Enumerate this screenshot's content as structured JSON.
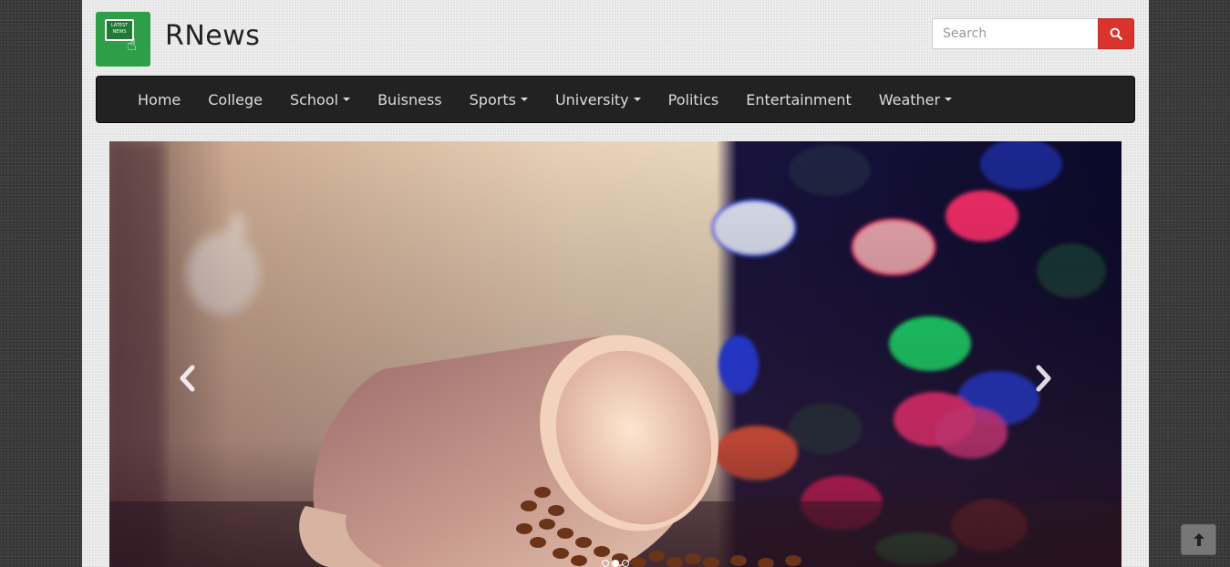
{
  "brand": {
    "name": "RNews",
    "logo_text": "LATEST NEWS",
    "logo_color": "#2e9e48"
  },
  "search": {
    "placeholder": "Search",
    "value": "",
    "button_icon": "search-icon",
    "button_color": "#d9332c"
  },
  "nav": {
    "items": [
      {
        "label": "Home",
        "dropdown": false
      },
      {
        "label": "College",
        "dropdown": false
      },
      {
        "label": "School",
        "dropdown": true
      },
      {
        "label": "Buisness",
        "dropdown": false
      },
      {
        "label": "Sports",
        "dropdown": true
      },
      {
        "label": "University",
        "dropdown": true
      },
      {
        "label": "Politics",
        "dropdown": false
      },
      {
        "label": "Entertainment",
        "dropdown": false
      },
      {
        "label": "Weather",
        "dropdown": true
      }
    ],
    "background": "#222222"
  },
  "carousel": {
    "prev_icon": "chevron-left-icon",
    "next_icon": "chevron-right-icon",
    "slide_count": 3,
    "active_index": 1
  },
  "back_to_top": {
    "icon": "arrow-up-icon"
  }
}
